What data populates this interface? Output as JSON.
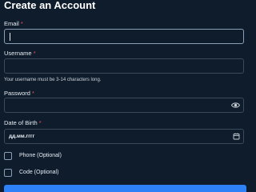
{
  "form": {
    "title": "Create an Account",
    "email": {
      "label": "Email",
      "required_mark": "*",
      "value": ""
    },
    "username": {
      "label": "Username",
      "required_mark": "*",
      "value": "",
      "hint": "Your username must be 3-14 characters long."
    },
    "password": {
      "label": "Password",
      "required_mark": "*",
      "value": "",
      "toggle_icon": "eye-icon"
    },
    "dob": {
      "label": "Date of Birth",
      "required_mark": "*",
      "value": "дд.мм.гггг",
      "picker_icon": "calendar-icon"
    },
    "phone": {
      "label": "Phone (Optional)",
      "checked": false
    },
    "code": {
      "label": "Code (Optional)",
      "checked": false
    },
    "submit": {
      "label": ""
    }
  },
  "colors": {
    "background": "#0f1c2c",
    "border": "#3b4a5c",
    "required": "#e5534b",
    "accent": "#2f81f7"
  }
}
